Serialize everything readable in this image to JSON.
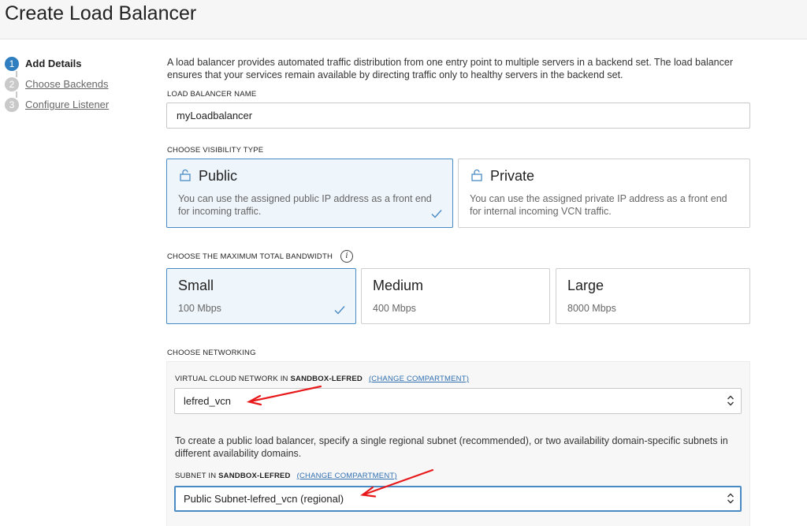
{
  "page": {
    "title": "Create Load Balancer"
  },
  "steps": [
    {
      "number": "1",
      "label": "Add Details",
      "active": true
    },
    {
      "number": "2",
      "label": "Choose Backends",
      "active": false
    },
    {
      "number": "3",
      "label": "Configure Listener",
      "active": false
    }
  ],
  "intro": "A load balancer provides automated traffic distribution from one entry point to multiple servers in a backend set. The load balancer ensures that your services remain available by directing traffic only to healthy servers in the backend set.",
  "name_field": {
    "label": "LOAD BALANCER NAME",
    "value": "myLoadbalancer"
  },
  "visibility": {
    "label": "CHOOSE VISIBILITY TYPE",
    "options": [
      {
        "title": "Public",
        "description": "You can use the assigned public IP address as a front end for incoming traffic.",
        "selected": true
      },
      {
        "title": "Private",
        "description": "You can use the assigned private IP address as a front end for internal incoming VCN traffic.",
        "selected": false
      }
    ]
  },
  "bandwidth": {
    "label": "CHOOSE THE MAXIMUM TOTAL BANDWIDTH",
    "info_icon": "i",
    "options": [
      {
        "title": "Small",
        "value": "100 Mbps",
        "selected": true
      },
      {
        "title": "Medium",
        "value": "400 Mbps",
        "selected": false
      },
      {
        "title": "Large",
        "value": "8000 Mbps",
        "selected": false
      }
    ]
  },
  "networking": {
    "label": "CHOOSE NETWORKING",
    "vcn": {
      "label_prefix": "VIRTUAL CLOUD NETWORK IN ",
      "compartment": "SANDBOX-LEFRED",
      "change_link": "(CHANGE COMPARTMENT)",
      "value": "lefred_vcn"
    },
    "help_text": "To create a public load balancer, specify a single regional subnet (recommended), or two availability domain-specific subnets in different availability domains.",
    "subnet": {
      "label_prefix": "SUBNET IN ",
      "compartment": "SANDBOX-LEFRED",
      "change_link": "(CHANGE COMPARTMENT)",
      "value": "Public Subnet-lefred_vcn (regional)"
    }
  },
  "colors": {
    "accent": "#2f7fc0",
    "selected_bg": "#eef5fb",
    "selected_border": "#4a8ac4",
    "annotation_arrow": "#e8191b"
  }
}
